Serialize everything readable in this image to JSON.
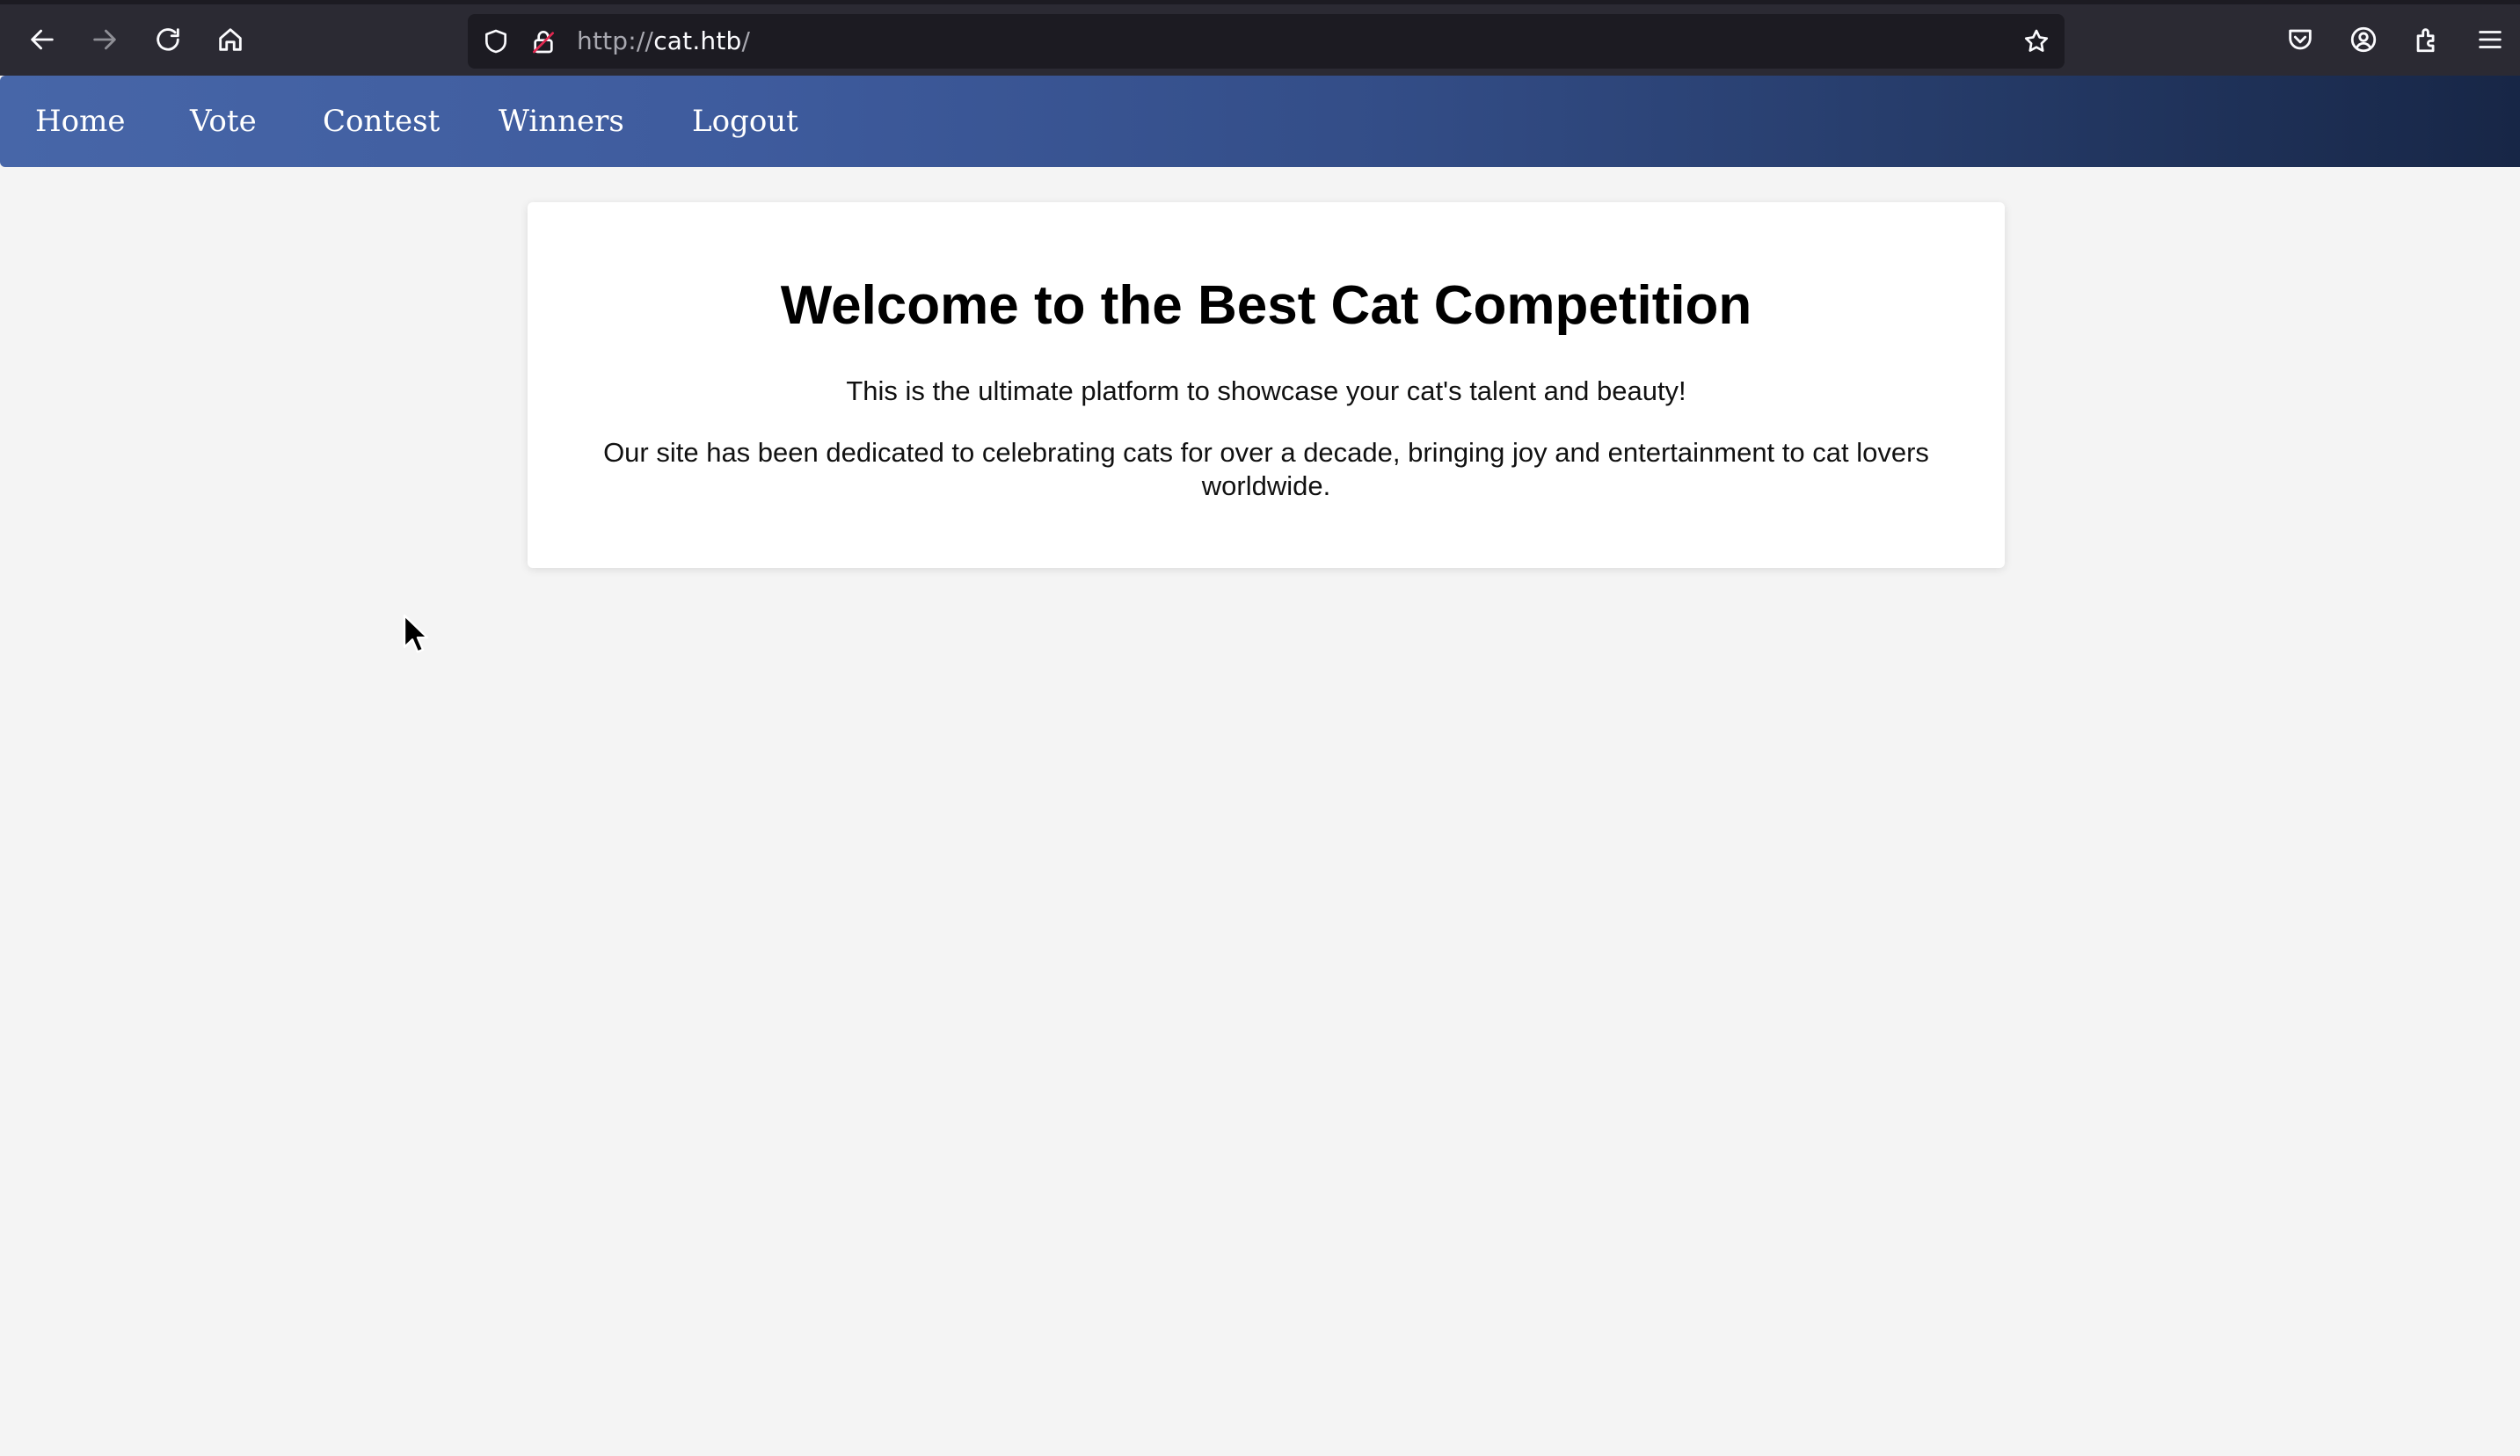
{
  "browser": {
    "url_protocol": "http://",
    "url_host": "cat.htb",
    "url_path": "/",
    "icons": [
      "back-icon",
      "forward-icon",
      "reload-icon",
      "home-icon",
      "shield-icon",
      "insecure-lock-icon",
      "star-icon",
      "pocket-icon",
      "account-icon",
      "extensions-icon",
      "menu-icon"
    ]
  },
  "nav": {
    "items": [
      {
        "label": "Home"
      },
      {
        "label": "Vote"
      },
      {
        "label": "Contest"
      },
      {
        "label": "Winners"
      },
      {
        "label": "Logout"
      }
    ]
  },
  "main": {
    "title": "Welcome to the Best Cat Competition",
    "intro": "This is the ultimate platform to showcase your cat's talent and beauty!",
    "description": "Our site has been dedicated to celebrating cats for over a decade, bringing joy and entertainment to cat lovers worldwide."
  },
  "colors": {
    "page_background": "#f4f4f4",
    "nav_gradient_start": "#4766a8",
    "nav_gradient_end": "#172646",
    "browser_chrome": "#2b2a33"
  }
}
